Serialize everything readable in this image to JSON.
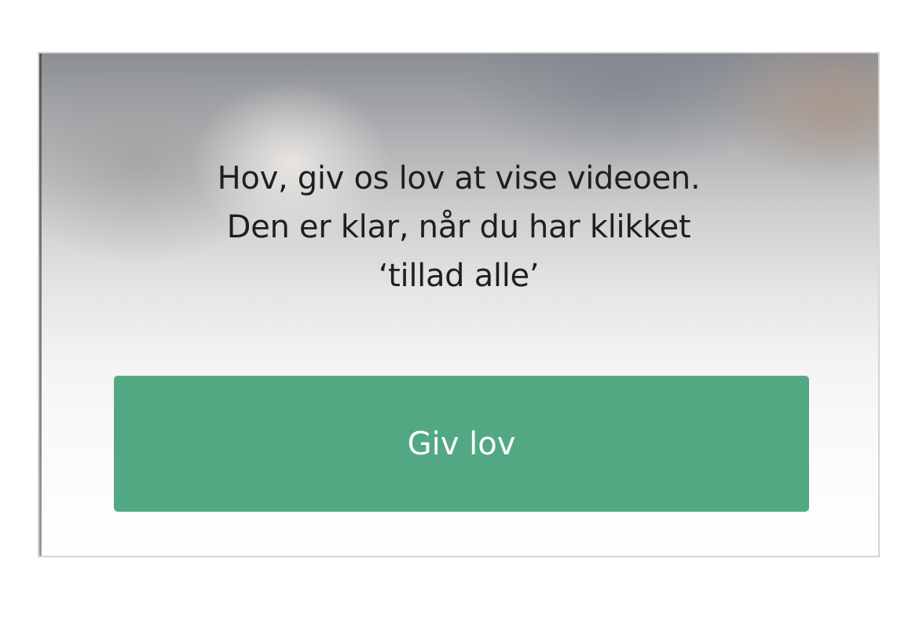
{
  "consent_overlay": {
    "message_lines": [
      "Hov, giv os lov at vise videoen.",
      "Den er klar, når du har klikket",
      "‘tillad alle’"
    ],
    "button_label": "Giv lov"
  },
  "colors": {
    "button_background": "#52a882",
    "button_text": "#ffffff",
    "message_text": "#1f1f1f",
    "frame_border": "#d4d4d4"
  }
}
